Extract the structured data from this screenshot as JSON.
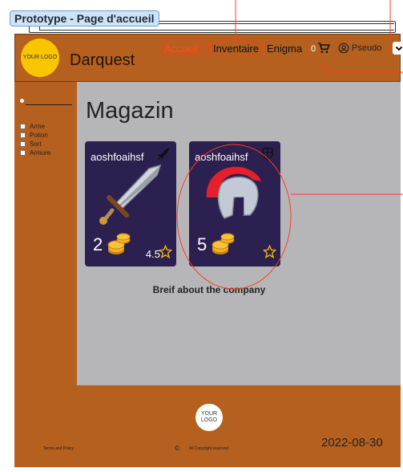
{
  "prototype_label": "Prototype - Page d'accueil",
  "header": {
    "logo_text": "YOUR LOGO",
    "brand": "Darquest",
    "nav": [
      "Accueil",
      "Inventaire",
      "Enigma"
    ],
    "cart_count": "0",
    "username": "Pseudo",
    "icons": [
      "cart-icon",
      "user-icon",
      "chevron-down-icon"
    ]
  },
  "sidebar": {
    "filters": [
      "Arme",
      "Potion",
      "Sort",
      "Armure"
    ]
  },
  "main": {
    "title": "Magazin",
    "cards": [
      {
        "name": "aoshfoaihsf",
        "price": "2",
        "rating": "4.5",
        "category_icon": "sword-icon",
        "image": "sword-image"
      },
      {
        "name": "aoshfoaihsf",
        "price": "5",
        "rating": "",
        "category_icon": "armor-icon",
        "image": "helmet-image"
      }
    ],
    "about": "Breif about the company"
  },
  "footer": {
    "logo_text": "YOUR LOGO",
    "terms": "Terms and Policy",
    "copyright": "All Copyright reserved",
    "date": "2022-08-30"
  },
  "colors": {
    "brown": "#b5601f",
    "card": "#2b2050",
    "accent": "#ff4d1f",
    "logo": "#f8c500",
    "gray": "#b6b6b8"
  }
}
